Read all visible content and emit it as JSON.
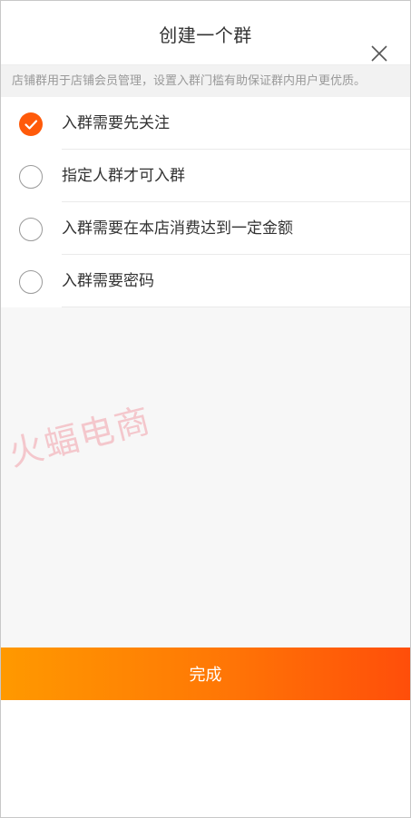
{
  "header": {
    "title": "创建一个群"
  },
  "notice": {
    "text": "店铺群用于店铺会员管理，设置入群门槛有助保证群内用户更优质。"
  },
  "options": [
    {
      "label": "入群需要先关注",
      "checked": true
    },
    {
      "label": "指定人群才可入群",
      "checked": false
    },
    {
      "label": "入群需要在本店消费达到一定金额",
      "checked": false
    },
    {
      "label": "入群需要密码",
      "checked": false
    }
  ],
  "watermark": {
    "text": "火蝠电商"
  },
  "footer": {
    "done_label": "完成"
  },
  "colors": {
    "accent": "#ff5a0a",
    "button_gradient_start": "#ff9900",
    "button_gradient_end": "#ff4e0a",
    "notice_text": "#999999"
  },
  "icons": {
    "close": "close-icon",
    "check": "check-icon"
  }
}
